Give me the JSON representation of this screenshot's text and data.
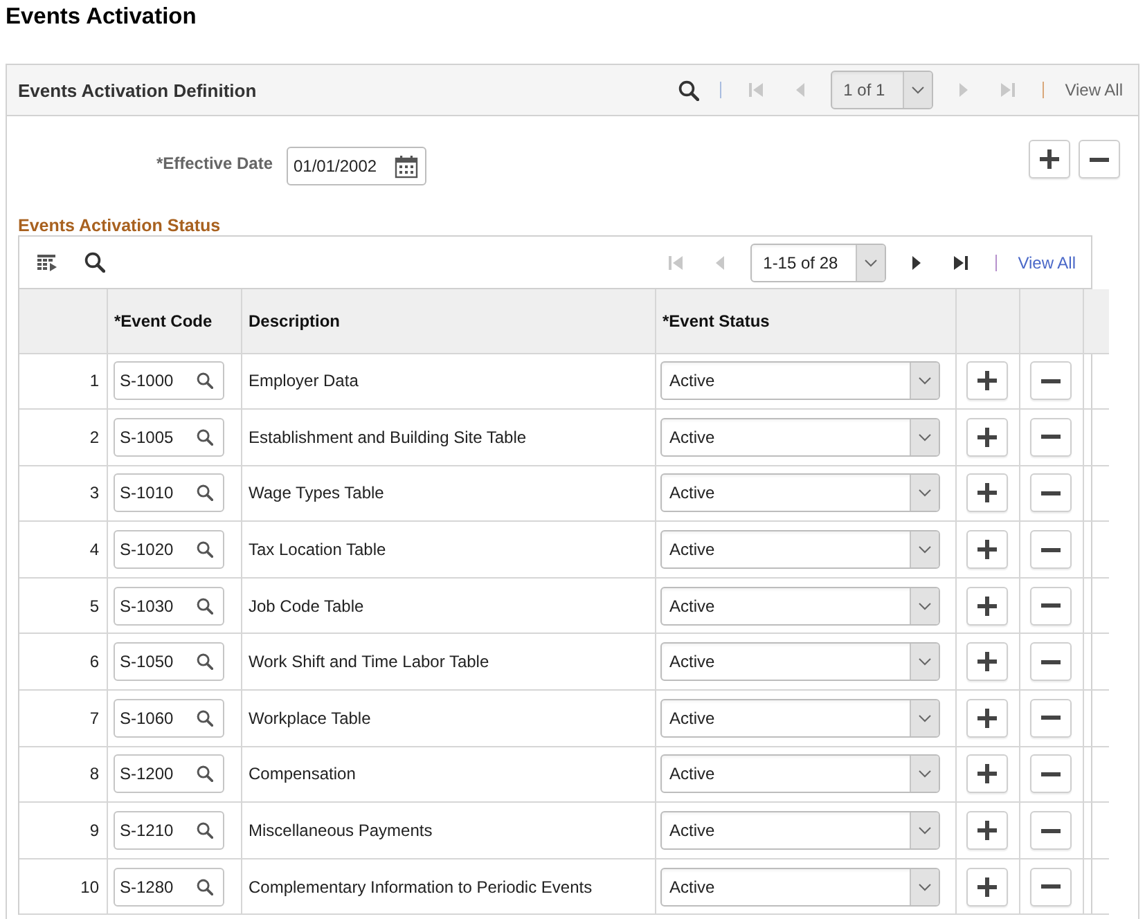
{
  "page_title": "Events Activation",
  "definition": {
    "title": "Events Activation Definition",
    "pager": [
      {
        "kind": "first",
        "disabled": true
      },
      {
        "kind": "prev",
        "disabled": true
      },
      {
        "kind": "range",
        "value": "1 of 1",
        "disabled": true
      },
      {
        "kind": "next",
        "disabled": true
      },
      {
        "kind": "last",
        "disabled": true
      },
      {
        "kind": "view_all",
        "label": "View All",
        "disabled": true
      }
    ],
    "effective_date": {
      "label": "*Effective Date",
      "value": "01/01/2002"
    }
  },
  "status_grid": {
    "title": "Events Activation Status",
    "pager": [
      {
        "kind": "first",
        "disabled": true
      },
      {
        "kind": "prev",
        "disabled": true
      },
      {
        "kind": "range",
        "value": "1-15 of 28",
        "disabled": false
      },
      {
        "kind": "next",
        "disabled": false
      },
      {
        "kind": "last",
        "disabled": false
      },
      {
        "kind": "view_all",
        "label": "View All",
        "disabled": false
      }
    ],
    "columns": [
      "*Event Code",
      "Description",
      "*Event Status"
    ],
    "rows": [
      {
        "number": "1",
        "event_code": "S-1000",
        "description": "Employer Data",
        "status": "Active"
      },
      {
        "number": "2",
        "event_code": "S-1005",
        "description": "Establishment and Building Site Table",
        "status": "Active"
      },
      {
        "number": "3",
        "event_code": "S-1010",
        "description": "Wage Types Table",
        "status": "Active"
      },
      {
        "number": "4",
        "event_code": "S-1020",
        "description": "Tax Location Table",
        "status": "Active"
      },
      {
        "number": "5",
        "event_code": "S-1030",
        "description": "Job Code Table",
        "status": "Active"
      },
      {
        "number": "6",
        "event_code": "S-1050",
        "description": "Work Shift and Time Labor Table",
        "status": "Active"
      },
      {
        "number": "7",
        "event_code": "S-1060",
        "description": "Workplace Table",
        "status": "Active"
      },
      {
        "number": "8",
        "event_code": "S-1200",
        "description": "Compensation",
        "status": "Active"
      },
      {
        "number": "9",
        "event_code": "S-1210",
        "description": "Miscellaneous Payments",
        "status": "Active"
      },
      {
        "number": "10",
        "event_code": "S-1280",
        "description": "Complementary Information to Periodic Events",
        "status": "Active"
      }
    ]
  }
}
